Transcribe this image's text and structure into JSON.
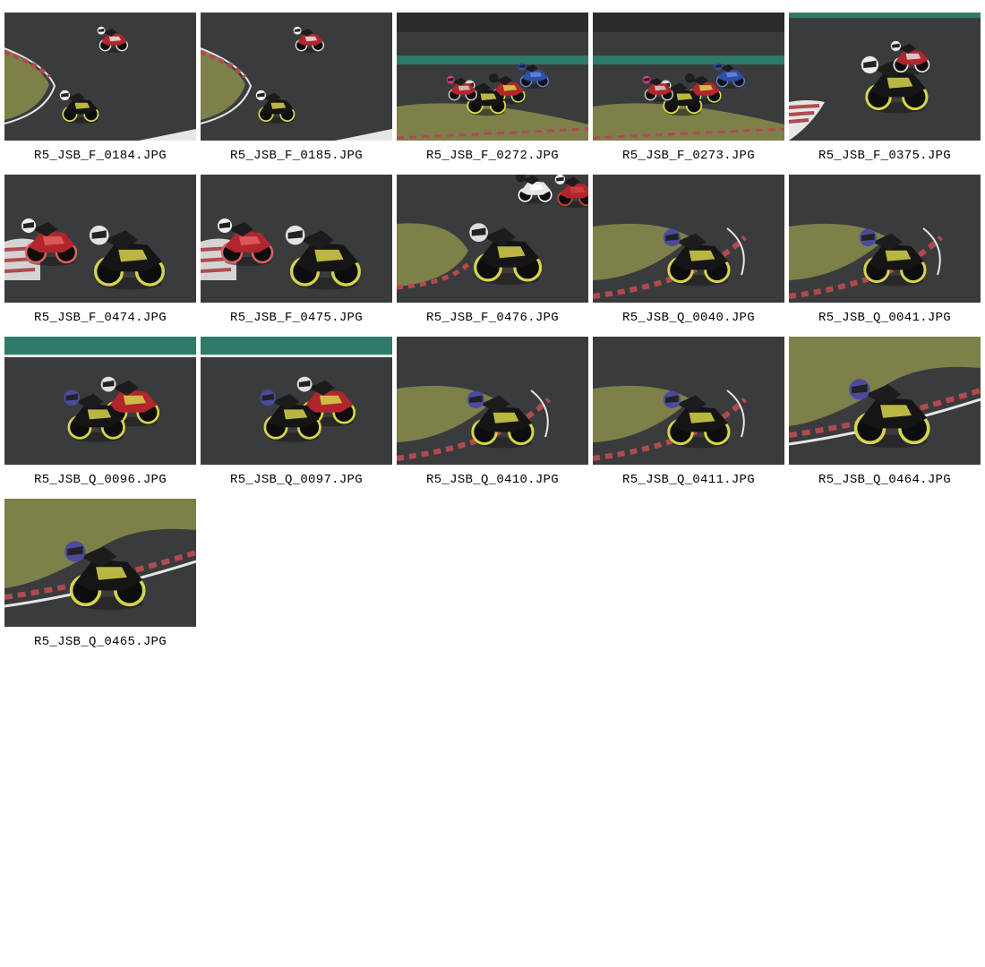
{
  "gallery": {
    "items": [
      {
        "filename": "R5_JSB_F_0184.JPG",
        "scene": "corner-far"
      },
      {
        "filename": "R5_JSB_F_0185.JPG",
        "scene": "corner-far"
      },
      {
        "filename": "R5_JSB_F_0272.JPG",
        "scene": "pack-grass"
      },
      {
        "filename": "R5_JSB_F_0273.JPG",
        "scene": "pack-grass"
      },
      {
        "filename": "R5_JSB_F_0375.JPG",
        "scene": "track-close"
      },
      {
        "filename": "R5_JSB_F_0474.JPG",
        "scene": "duo-close"
      },
      {
        "filename": "R5_JSB_F_0475.JPG",
        "scene": "duo-close"
      },
      {
        "filename": "R5_JSB_F_0476.JPG",
        "scene": "duo-grass"
      },
      {
        "filename": "R5_JSB_Q_0040.JPG",
        "scene": "solo-kerb"
      },
      {
        "filename": "R5_JSB_Q_0041.JPG",
        "scene": "solo-kerb"
      },
      {
        "filename": "R5_JSB_Q_0096.JPG",
        "scene": "pair-track"
      },
      {
        "filename": "R5_JSB_Q_0097.JPG",
        "scene": "pair-track"
      },
      {
        "filename": "R5_JSB_Q_0410.JPG",
        "scene": "solo-kerb"
      },
      {
        "filename": "R5_JSB_Q_0411.JPG",
        "scene": "solo-kerb"
      },
      {
        "filename": "R5_JSB_Q_0464.JPG",
        "scene": "solo-grass"
      },
      {
        "filename": "R5_JSB_Q_0465.JPG",
        "scene": "solo-grass"
      }
    ]
  },
  "colors": {
    "asphalt": "#3a3b3d",
    "asphalt_dark": "#2a2b2d",
    "grass": "#7d8048",
    "barrier": "#2f7a68",
    "kerb_red": "#b04a4e",
    "kerb_white": "#e6e6e6",
    "bike_black": "#151515",
    "bike_yellow": "#d6d44a",
    "rival_red": "#b0262c",
    "rival_blue": "#2c4fa8",
    "caption": "#000000",
    "background": "#ffffff"
  }
}
